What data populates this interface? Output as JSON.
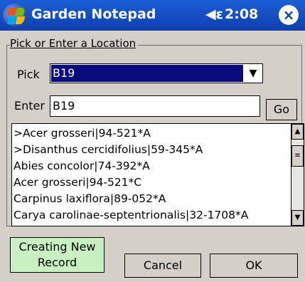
{
  "titlebar": {
    "app_title": "Garden Notepad",
    "volume_icon": "◀ε",
    "clock": "2:08",
    "close_icon": "×"
  },
  "location_group": {
    "legend": "Pick or Enter a Location"
  },
  "pick": {
    "label": "Pick",
    "value": "B19",
    "arrow": "▼"
  },
  "enter": {
    "label": "Enter",
    "value": "B19"
  },
  "go_button": {
    "label": "Go"
  },
  "list": {
    "items": [
      ">Acer grosseri|94-521*A",
      ">Disanthus cercidifolius|59-345*A",
      "Abies concolor|74-392*A",
      "Acer grosseri|94-521*C",
      "Carpinus laxiflora|89-052*A",
      "Carya carolinae-septentrionalis|32-1708*A"
    ],
    "scroll_up": "▲",
    "scroll_down": "▼",
    "scroll_thumb": "≡"
  },
  "status": {
    "line1": "Creating New",
    "line2": "Record",
    "color": "#c9f0c0"
  },
  "buttons": {
    "cancel": "Cancel",
    "ok": "OK"
  }
}
